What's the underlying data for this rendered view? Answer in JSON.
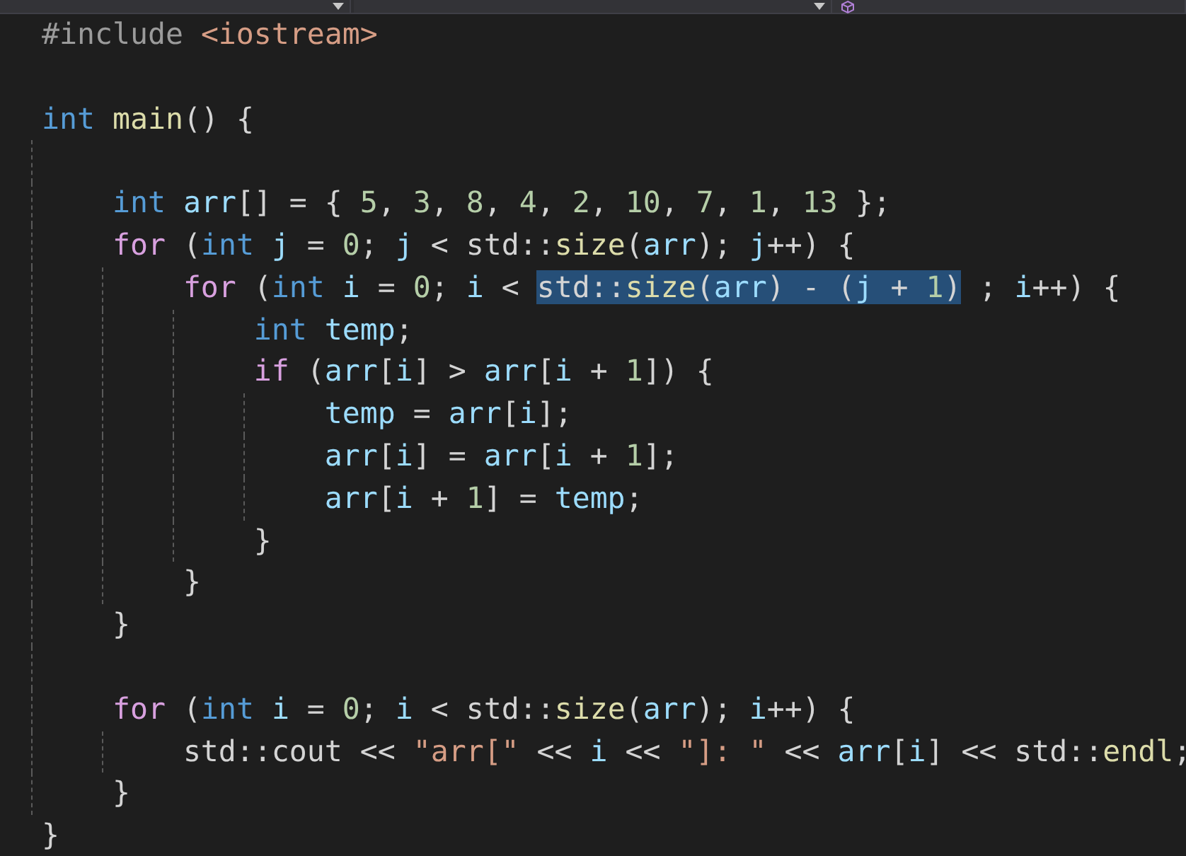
{
  "navigation_bar": {
    "dropdowns": [
      {
        "kind": "plain"
      },
      {
        "kind": "plain"
      },
      {
        "kind": "member"
      }
    ]
  },
  "editor": {
    "lines": [
      {
        "tokens": [
          {
            "text": "#include ",
            "kind": "preproc"
          },
          {
            "text": "<iostream>",
            "kind": "string"
          }
        ]
      },
      {
        "kind": "blank"
      },
      {
        "tokens": [
          {
            "text": "int ",
            "kind": "keyword"
          },
          {
            "text": "main",
            "kind": "function"
          },
          {
            "text": "() {",
            "kind": "plain"
          }
        ]
      },
      {
        "kind": "blank"
      },
      {
        "tokens": [
          {
            "text": "    int ",
            "kind": "keyword"
          },
          {
            "text": "arr",
            "kind": "variable"
          },
          {
            "text": "[] = { ",
            "kind": "plain"
          },
          {
            "text": "5",
            "kind": "number"
          },
          {
            "text": ", ",
            "kind": "plain"
          },
          {
            "text": "3",
            "kind": "number"
          },
          {
            "text": ", ",
            "kind": "plain"
          },
          {
            "text": "8",
            "kind": "number"
          },
          {
            "text": ", ",
            "kind": "plain"
          },
          {
            "text": "4",
            "kind": "number"
          },
          {
            "text": ", ",
            "kind": "plain"
          },
          {
            "text": "2",
            "kind": "number"
          },
          {
            "text": ", ",
            "kind": "plain"
          },
          {
            "text": "10",
            "kind": "number"
          },
          {
            "text": ", ",
            "kind": "plain"
          },
          {
            "text": "7",
            "kind": "number"
          },
          {
            "text": ", ",
            "kind": "plain"
          },
          {
            "text": "1",
            "kind": "number"
          },
          {
            "text": ", ",
            "kind": "plain"
          },
          {
            "text": "13",
            "kind": "number"
          },
          {
            "text": " };",
            "kind": "plain"
          }
        ]
      },
      {
        "tokens": [
          {
            "text": "    for",
            "kind": "control"
          },
          {
            "text": " (",
            "kind": "plain"
          },
          {
            "text": "int ",
            "kind": "keyword"
          },
          {
            "text": "j",
            "kind": "variable"
          },
          {
            "text": " = ",
            "kind": "plain"
          },
          {
            "text": "0",
            "kind": "number"
          },
          {
            "text": "; ",
            "kind": "plain"
          },
          {
            "text": "j",
            "kind": "variable"
          },
          {
            "text": " < std::",
            "kind": "plain"
          },
          {
            "text": "size",
            "kind": "function"
          },
          {
            "text": "(",
            "kind": "plain"
          },
          {
            "text": "arr",
            "kind": "variable"
          },
          {
            "text": "); ",
            "kind": "plain"
          },
          {
            "text": "j",
            "kind": "variable"
          },
          {
            "text": "++) {",
            "kind": "plain"
          }
        ]
      },
      {
        "tokens": [
          {
            "text": "        for",
            "kind": "control",
            "selected": false
          },
          {
            "text": " (",
            "kind": "plain",
            "selected": false
          },
          {
            "text": "int ",
            "kind": "keyword",
            "selected": false
          },
          {
            "text": "i",
            "kind": "variable",
            "selected": false
          },
          {
            "text": " = ",
            "kind": "plain",
            "selected": false
          },
          {
            "text": "0",
            "kind": "number",
            "selected": false
          },
          {
            "text": "; ",
            "kind": "plain",
            "selected": false
          },
          {
            "text": "i",
            "kind": "variable",
            "selected": false
          },
          {
            "text": " < ",
            "kind": "plain",
            "selected": false
          },
          {
            "text": "std::",
            "kind": "plain",
            "selected": true
          },
          {
            "text": "size",
            "kind": "function",
            "selected": true
          },
          {
            "text": "(",
            "kind": "plain",
            "selected": true
          },
          {
            "text": "arr",
            "kind": "variable",
            "selected": true
          },
          {
            "text": ") - (",
            "kind": "plain",
            "selected": true
          },
          {
            "text": "j",
            "kind": "variable",
            "selected": true
          },
          {
            "text": " + ",
            "kind": "plain",
            "selected": true
          },
          {
            "text": "1",
            "kind": "number",
            "selected": true
          },
          {
            "text": ")",
            "kind": "plain",
            "selected": true
          },
          {
            "text": " ; ",
            "kind": "plain",
            "selected": false
          },
          {
            "text": "i",
            "kind": "variable",
            "selected": false
          },
          {
            "text": "++) {",
            "kind": "plain",
            "selected": false
          }
        ]
      },
      {
        "tokens": [
          {
            "text": "            int ",
            "kind": "keyword"
          },
          {
            "text": "temp",
            "kind": "variable"
          },
          {
            "text": ";",
            "kind": "plain"
          }
        ]
      },
      {
        "tokens": [
          {
            "text": "            if",
            "kind": "control"
          },
          {
            "text": " (",
            "kind": "plain"
          },
          {
            "text": "arr",
            "kind": "variable"
          },
          {
            "text": "[",
            "kind": "plain"
          },
          {
            "text": "i",
            "kind": "variable"
          },
          {
            "text": "] > ",
            "kind": "plain"
          },
          {
            "text": "arr",
            "kind": "variable"
          },
          {
            "text": "[",
            "kind": "plain"
          },
          {
            "text": "i",
            "kind": "variable"
          },
          {
            "text": " + ",
            "kind": "plain"
          },
          {
            "text": "1",
            "kind": "number"
          },
          {
            "text": "]) {",
            "kind": "plain"
          }
        ]
      },
      {
        "tokens": [
          {
            "text": "                temp",
            "kind": "variable"
          },
          {
            "text": " = ",
            "kind": "plain"
          },
          {
            "text": "arr",
            "kind": "variable"
          },
          {
            "text": "[",
            "kind": "plain"
          },
          {
            "text": "i",
            "kind": "variable"
          },
          {
            "text": "];",
            "kind": "plain"
          }
        ]
      },
      {
        "tokens": [
          {
            "text": "                arr",
            "kind": "variable"
          },
          {
            "text": "[",
            "kind": "plain"
          },
          {
            "text": "i",
            "kind": "variable"
          },
          {
            "text": "] = ",
            "kind": "plain"
          },
          {
            "text": "arr",
            "kind": "variable"
          },
          {
            "text": "[",
            "kind": "plain"
          },
          {
            "text": "i",
            "kind": "variable"
          },
          {
            "text": " + ",
            "kind": "plain"
          },
          {
            "text": "1",
            "kind": "number"
          },
          {
            "text": "];",
            "kind": "plain"
          }
        ]
      },
      {
        "tokens": [
          {
            "text": "                arr",
            "kind": "variable"
          },
          {
            "text": "[",
            "kind": "plain"
          },
          {
            "text": "i",
            "kind": "variable"
          },
          {
            "text": " + ",
            "kind": "plain"
          },
          {
            "text": "1",
            "kind": "number"
          },
          {
            "text": "] = ",
            "kind": "plain"
          },
          {
            "text": "temp",
            "kind": "variable"
          },
          {
            "text": ";",
            "kind": "plain"
          }
        ]
      },
      {
        "tokens": [
          {
            "text": "            }",
            "kind": "plain"
          }
        ]
      },
      {
        "tokens": [
          {
            "text": "        }",
            "kind": "plain"
          }
        ]
      },
      {
        "tokens": [
          {
            "text": "    }",
            "kind": "plain"
          }
        ]
      },
      {
        "kind": "blank"
      },
      {
        "tokens": [
          {
            "text": "    for",
            "kind": "control"
          },
          {
            "text": " (",
            "kind": "plain"
          },
          {
            "text": "int ",
            "kind": "keyword"
          },
          {
            "text": "i",
            "kind": "variable"
          },
          {
            "text": " = ",
            "kind": "plain"
          },
          {
            "text": "0",
            "kind": "number"
          },
          {
            "text": "; ",
            "kind": "plain"
          },
          {
            "text": "i",
            "kind": "variable"
          },
          {
            "text": " < std::",
            "kind": "plain"
          },
          {
            "text": "size",
            "kind": "function"
          },
          {
            "text": "(",
            "kind": "plain"
          },
          {
            "text": "arr",
            "kind": "variable"
          },
          {
            "text": "); ",
            "kind": "plain"
          },
          {
            "text": "i",
            "kind": "variable"
          },
          {
            "text": "++) {",
            "kind": "plain"
          }
        ]
      },
      {
        "tokens": [
          {
            "text": "        std::cout << ",
            "kind": "plain"
          },
          {
            "text": "\"arr[\"",
            "kind": "string"
          },
          {
            "text": " << ",
            "kind": "plain"
          },
          {
            "text": "i",
            "kind": "variable"
          },
          {
            "text": " << ",
            "kind": "plain"
          },
          {
            "text": "\"]: \"",
            "kind": "string"
          },
          {
            "text": " << ",
            "kind": "plain"
          },
          {
            "text": "arr",
            "kind": "variable"
          },
          {
            "text": "[",
            "kind": "plain"
          },
          {
            "text": "i",
            "kind": "variable"
          },
          {
            "text": "] << std::",
            "kind": "plain"
          },
          {
            "text": "endl",
            "kind": "function"
          },
          {
            "text": ";",
            "kind": "plain"
          }
        ]
      },
      {
        "tokens": [
          {
            "text": "    }",
            "kind": "plain"
          }
        ]
      },
      {
        "tokens": [
          {
            "text": "}",
            "kind": "plain"
          }
        ]
      }
    ]
  }
}
